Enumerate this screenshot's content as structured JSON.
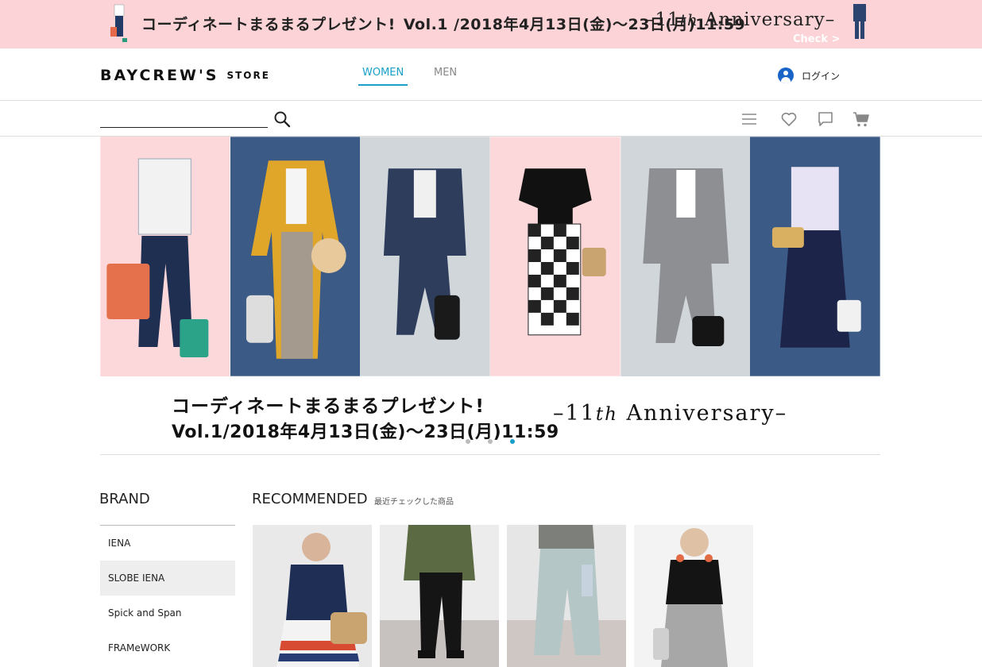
{
  "promo": {
    "title": "コーディネートまるまるプレゼント!",
    "vol": "Vol.1 /2018年4月13日(金)〜23日(月)11:59",
    "anniversary_prefix": "–11",
    "anniversary_th": "th",
    "anniversary_word": "Anniversary–",
    "check_label": "Check >"
  },
  "header": {
    "logo": "BAYCREW'S",
    "logo_store": "STORE",
    "tabs": [
      {
        "label": "WOMEN",
        "active": true
      },
      {
        "label": "MEN",
        "active": false
      }
    ],
    "login_label": "ログイン"
  },
  "search": {
    "placeholder": "",
    "icons": [
      "search-icon",
      "menu-icon",
      "heart-icon",
      "chat-icon",
      "cart-icon"
    ]
  },
  "hero": {
    "panel_colors": [
      "#fcd8db",
      "#3c5a86",
      "#d0d6da",
      "#fcd8db",
      "#d0d6da",
      "#3c5a86"
    ],
    "line1": "コーディネートまるまるプレゼント!",
    "line2": "Vol.1/2018年4月13日(金)〜23日(月)11:59",
    "anniversary_prefix": "–11",
    "anniversary_th": "th",
    "anniversary_word": "Anniversary–",
    "slide_count": 3,
    "active_slide": 3
  },
  "brand": {
    "title": "BRAND",
    "items": [
      {
        "label": "IENA",
        "active": false
      },
      {
        "label": "SLOBE IENA",
        "active": true
      },
      {
        "label": "Spick and Span",
        "active": false
      },
      {
        "label": "FRAMeWORK",
        "active": false
      }
    ]
  },
  "recommended": {
    "title": "RECOMMENDED",
    "subtitle": "最近チェックした商品",
    "product_count": 4
  },
  "colors": {
    "accent": "#1aa0c8",
    "promo_bg": "#fcd3d6",
    "user_icon": "#1a64c8"
  }
}
